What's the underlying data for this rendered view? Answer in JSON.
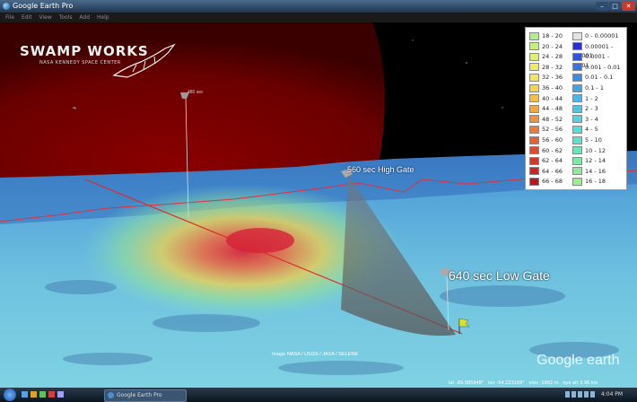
{
  "window": {
    "title": "Google Earth Pro",
    "controls": [
      "–",
      "□",
      "✕"
    ]
  },
  "menu": [
    "File",
    "Edit",
    "View",
    "Tools",
    "Add",
    "Help"
  ],
  "logo": {
    "name": "SWAMP WORKS",
    "subtitle": "NASA KENNEDY SPACE CENTER"
  },
  "placemarks": [
    {
      "label": "480 sec"
    },
    {
      "label": "560 sec High Gate"
    },
    {
      "label": "640 sec Low Gate"
    }
  ],
  "legend": {
    "left": [
      {
        "range": "18 - 20",
        "color": "#b0ef8a"
      },
      {
        "range": "20 - 24",
        "color": "#c6f07c"
      },
      {
        "range": "24 - 28",
        "color": "#dcf06e"
      },
      {
        "range": "28 - 32",
        "color": "#ecec5e"
      },
      {
        "range": "32 - 36",
        "color": "#f4e45a"
      },
      {
        "range": "36 - 40",
        "color": "#f5d44c"
      },
      {
        "range": "40 - 44",
        "color": "#f4bf44"
      },
      {
        "range": "44 - 48",
        "color": "#f3a73e"
      },
      {
        "range": "48 - 52",
        "color": "#f1913a"
      },
      {
        "range": "52 - 56",
        "color": "#ee7a36"
      },
      {
        "range": "56 - 60",
        "color": "#e86032"
      },
      {
        "range": "60 - 62",
        "color": "#e2482e"
      },
      {
        "range": "62 - 64",
        "color": "#da342a"
      },
      {
        "range": "64 - 66",
        "color": "#cf2426"
      },
      {
        "range": "66 - 68",
        "color": "#c01420"
      }
    ],
    "right": [
      {
        "range": "0 - 0.00001",
        "color": "#e2e2e2"
      },
      {
        "range": "0.00001 - 0.0001",
        "color": "#2a2ed6"
      },
      {
        "range": "0.0001 - 0.001",
        "color": "#2e55e0"
      },
      {
        "range": "0.001 - 0.01",
        "color": "#3574e4"
      },
      {
        "range": "0.01 - 0.1",
        "color": "#3b8ee6"
      },
      {
        "range": "0.1 - 1",
        "color": "#42a4e8"
      },
      {
        "range": "1 - 2",
        "color": "#48b6e8"
      },
      {
        "range": "2 - 3",
        "color": "#4ec6e6"
      },
      {
        "range": "3 - 4",
        "color": "#52d2e2"
      },
      {
        "range": "4 - 5",
        "color": "#56dcda"
      },
      {
        "range": "5 - 10",
        "color": "#5ae2cc"
      },
      {
        "range": "10 - 12",
        "color": "#66e6bc"
      },
      {
        "range": "12 - 14",
        "color": "#76eaa8"
      },
      {
        "range": "14 - 16",
        "color": "#88ec98"
      },
      {
        "range": "16 - 18",
        "color": "#9cee8c"
      }
    ]
  },
  "attribution": "Image NASA / USGS / JAXA / SELENE",
  "watermark": "Google earth",
  "status": {
    "lat": "lat  -89.985948°",
    "lon": "lon  -54.223169°",
    "elev": "elev -1962 m",
    "eye": "eye alt  3.96 km"
  },
  "taskbar": {
    "app": "Google Earth Pro",
    "clock": "4:04 PM"
  }
}
